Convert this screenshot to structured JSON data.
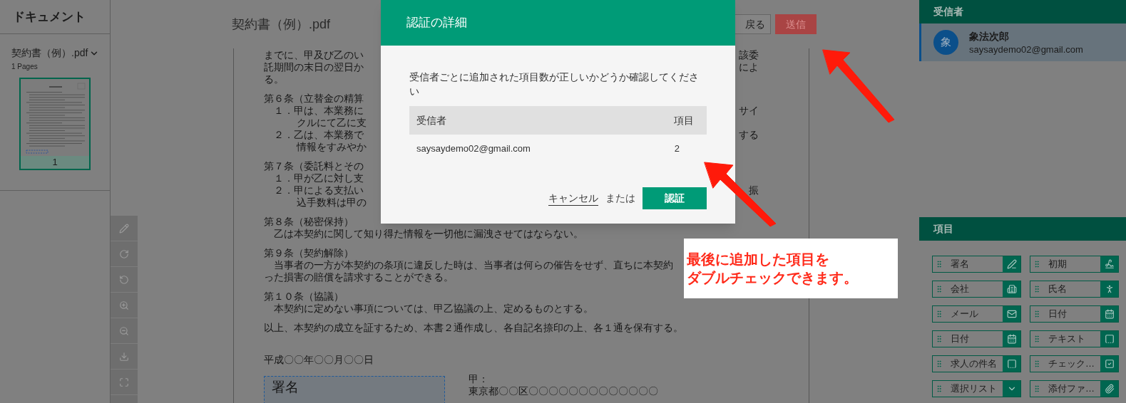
{
  "sidebar": {
    "title": "ドキュメント",
    "document": {
      "name": "契約書（例）.pdf",
      "pages": "1 Pages",
      "thumbnail_label": "1",
      "selected": true
    }
  },
  "viewer": {
    "title": "契約書（例）.pdf",
    "buttons": [
      {
        "label": "戻る",
        "kind": "secondary"
      },
      {
        "label": "送信",
        "kind": "primary"
      }
    ]
  },
  "document_lines": [
    {
      "kind": "body",
      "text": "までに、甲及び乙のい",
      "right": "該委"
    },
    {
      "kind": "body",
      "text": "託期間の末日の翌日か",
      "right": "によ"
    },
    {
      "kind": "body",
      "text": "る。"
    },
    {
      "kind": "heading",
      "text": "第６条（立替金の精算"
    },
    {
      "kind": "item",
      "text": "１．甲は、本業務に",
      "right": "サイ"
    },
    {
      "kind": "continuation",
      "text": "クルにて乙に支"
    },
    {
      "kind": "item",
      "text": "２．乙は、本業務で",
      "right": "する"
    },
    {
      "kind": "continuation",
      "text": "情報をすみやか"
    },
    {
      "kind": "heading",
      "text": "第７条（委託料とその"
    },
    {
      "kind": "item",
      "text": "１．甲が乙に対し支"
    },
    {
      "kind": "item",
      "text": "２．甲による支払い",
      "right": "振"
    },
    {
      "kind": "continuation",
      "text": "込手数料は甲の"
    },
    {
      "kind": "heading",
      "text": "第８条（秘密保持）"
    },
    {
      "kind": "paragraph",
      "text": "乙は本契約に関して知り得た情報を一切他に漏洩させてはならない。"
    },
    {
      "kind": "heading",
      "text": "第９条（契約解除）"
    },
    {
      "kind": "paragraph",
      "text": "当事者の一方が本契約の条項に違反した時は、当事者は何らの催告をせず、直ちに本契約"
    },
    {
      "kind": "body",
      "text": "った損害の賠償を請求することができる。"
    },
    {
      "kind": "heading",
      "text": "第１０条（協議）"
    },
    {
      "kind": "paragraph",
      "text": "本契約に定めない事項については、甲乙協議の上、定めるものとする。"
    },
    {
      "kind": "heading",
      "text": "以上、本契約の成立を証するため、本書２通作成し、各自記名捺印の上、各１通を保有する。"
    },
    {
      "kind": "date",
      "text": "平成〇〇年〇〇月〇〇日"
    }
  ],
  "signature": {
    "field_label": "署名",
    "party": "甲：",
    "address": "東京都〇〇区〇〇〇〇〇〇〇〇〇〇〇〇〇"
  },
  "dialog": {
    "title": "認証の詳細",
    "message": "受信者ごとに追加された項目数が正しいかどうか確認してください",
    "table": {
      "columns": [
        "受信者",
        "項目"
      ],
      "rows": [
        [
          "saysaydemo02@gmail.com",
          "2"
        ]
      ]
    },
    "cancel": "キャンセル",
    "or": "または",
    "confirm": "認証"
  },
  "annotation": {
    "lines": [
      "最後に追加した項目を",
      "ダブルチェックできます。"
    ]
  },
  "recipients": {
    "title": "受信者",
    "items": [
      {
        "avatar": "象",
        "name": "象法次郎",
        "email": "saysaydemo02@gmail.com",
        "selected": true
      }
    ]
  },
  "fields": {
    "title": "項目",
    "items": [
      {
        "label": "署名",
        "kind": "signature"
      },
      {
        "label": "初期",
        "kind": "initials"
      },
      {
        "label": "会社",
        "kind": "company"
      },
      {
        "label": "氏名",
        "kind": "name"
      },
      {
        "label": "メール",
        "kind": "email"
      },
      {
        "label": "日付",
        "kind": "date"
      },
      {
        "label": "日付",
        "kind": "date"
      },
      {
        "label": "テキスト",
        "kind": "text"
      },
      {
        "label": "求人の件名",
        "kind": "text"
      },
      {
        "label": "チェック…",
        "kind": "checkbox"
      },
      {
        "label": "選択リスト",
        "kind": "list"
      },
      {
        "label": "添付ファ…",
        "kind": "attachment"
      }
    ]
  }
}
